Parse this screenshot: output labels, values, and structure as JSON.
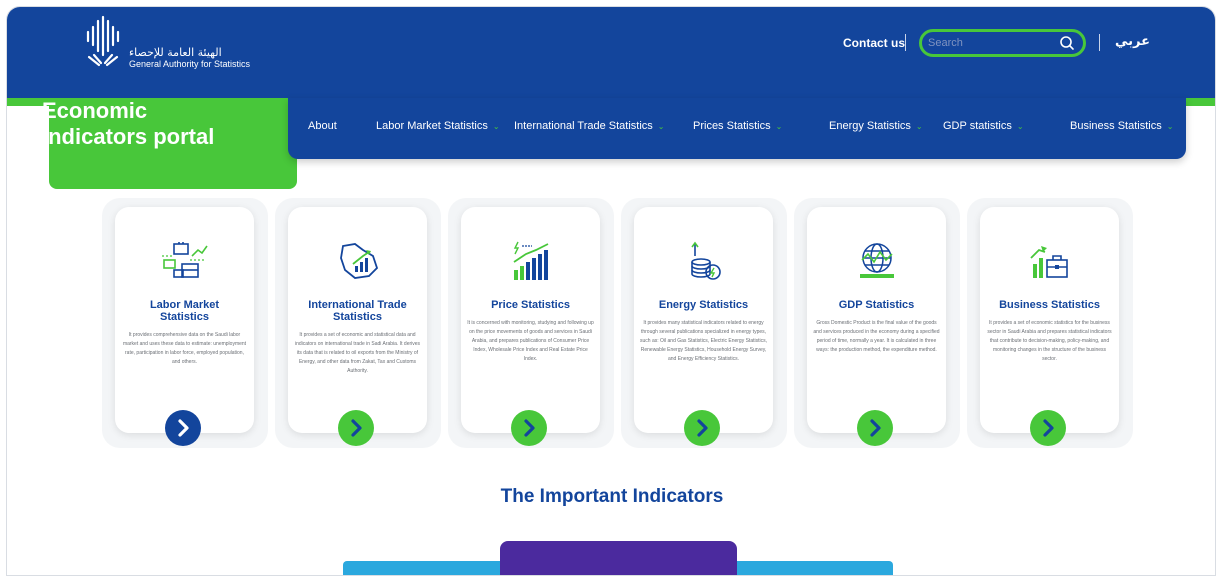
{
  "header": {
    "logo_ar": "الهيئة العامة للإحصاء",
    "logo_en": "General Authority for Statistics",
    "contact": "Contact us",
    "search_placeholder": "Search",
    "lang": "عربي"
  },
  "portal": {
    "title_line1": "Economic",
    "title_line2": "indicators portal"
  },
  "nav": {
    "items": [
      {
        "label": "About",
        "has_dropdown": false
      },
      {
        "label": "Labor Market Statistics",
        "has_dropdown": true
      },
      {
        "label": "International Trade Statistics",
        "has_dropdown": true
      },
      {
        "label": "Prices Statistics",
        "has_dropdown": true
      },
      {
        "label": "Energy Statistics",
        "has_dropdown": true
      },
      {
        "label": "GDP statistics",
        "has_dropdown": true
      },
      {
        "label": "Business Statistics",
        "has_dropdown": true
      }
    ]
  },
  "cards": [
    {
      "title1": "Labor Market",
      "title2": "Statistics",
      "icon": "briefcase-chart-icon",
      "desc": "It provides comprehensive data on the Saudi labor market and uses these data to estimate: unemployment rate, participation in labor force, employed population, and others."
    },
    {
      "title1": "International Trade",
      "title2": "Statistics",
      "icon": "saudi-map-chart-icon",
      "desc": "It provides a set of economic and statistical data and indicators on international trade in Sadi Arabia. It derives its data that is related to oil exports from the Ministry of Energy, and other data from Zakat, Tax and Customs Authority."
    },
    {
      "title1": "Price Statistics",
      "title2": "",
      "icon": "price-bars-icon",
      "desc": "It is concerned with monitoring, studying and following up on the price movements of goods and services in Saudi Arabia, and prepares publications of Consumer Price Index, Wholesale Price Index and Real Estate Price Index."
    },
    {
      "title1": "Energy Statistics",
      "title2": "",
      "icon": "coins-energy-icon",
      "desc": "It provides many statistical indicators related to energy through several publications specialized in energy types, such as: Oil and Gas Statistics, Electric Energy Statistics, Renewable Energy Statistics, Household Energy Survey, and Energy Efficiency Statistics."
    },
    {
      "title1": "GDP Statistics",
      "title2": "",
      "icon": "globe-icon",
      "desc": "Gross Domestic Product is the final value of the goods and services produced in the economy during a specified period of time, normally a year. It is calculated in three ways: the production method, the expenditure method."
    },
    {
      "title1": "Business Statistics",
      "title2": "",
      "icon": "business-chart-icon",
      "desc": "It provides a set of economic statistics for the business sector in Saudi Arabia and prepares statistical indicators that contribute to decision-making, policy-making, and monitoring changes in the structure of the business sector."
    }
  ],
  "section": {
    "title": "The Important Indicators"
  },
  "colors": {
    "primary_blue": "#13459c",
    "accent_green": "#48c73a",
    "purple": "#4b2a9e",
    "teal": "#2ba8de"
  }
}
